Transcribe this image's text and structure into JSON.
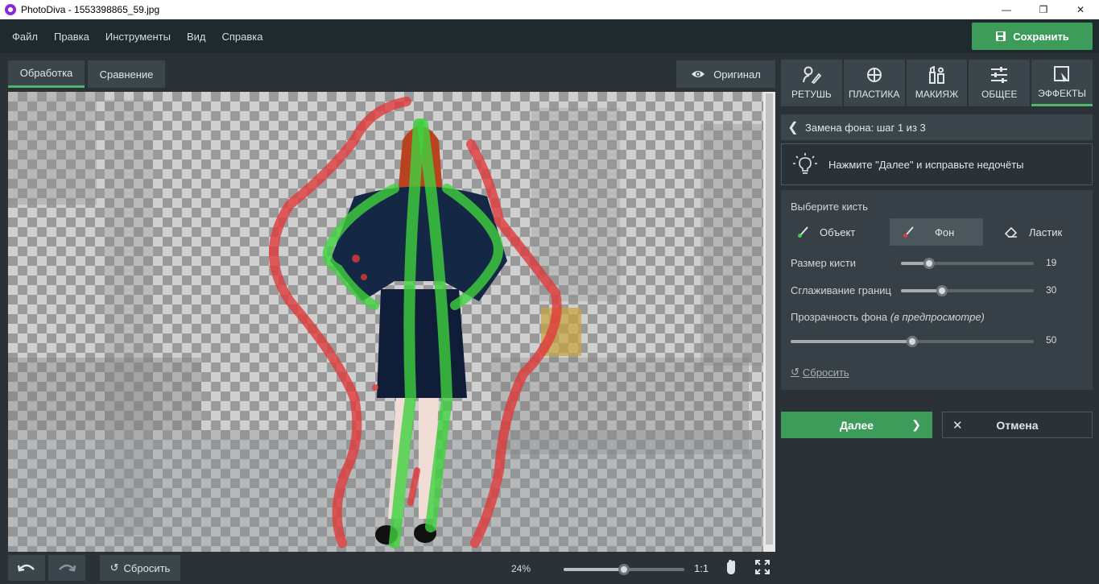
{
  "window": {
    "title": "PhotoDiva - 1553398865_59.jpg"
  },
  "menu": [
    "Файл",
    "Правка",
    "Инструменты",
    "Вид",
    "Справка"
  ],
  "save_button": "Сохранить",
  "view_tabs": {
    "process": "Обработка",
    "compare": "Сравнение",
    "original": "Оригинал"
  },
  "tools": [
    {
      "label": "РЕТУШЬ",
      "icon": "retouch-icon"
    },
    {
      "label": "ПЛАСТИКА",
      "icon": "plastic-icon"
    },
    {
      "label": "МАКИЯЖ",
      "icon": "makeup-icon"
    },
    {
      "label": "ОБЩЕЕ",
      "icon": "sliders-icon"
    },
    {
      "label": "ЭФФЕКТЫ",
      "icon": "effects-icon",
      "active": true
    }
  ],
  "step": {
    "title": "Замена фона: шаг 1 из 3"
  },
  "hint": "Нажмите \"Далее\" и исправьте недочёты",
  "brush": {
    "choose_label": "Выберите кисть",
    "options": {
      "object": "Объект",
      "background": "Фон",
      "eraser": "Ластик"
    },
    "selected": "background"
  },
  "settings": {
    "size": {
      "label": "Размер кисти",
      "value": 19,
      "fraction": 0.21
    },
    "smoothing": {
      "label": "Сглаживание границ",
      "value": 30,
      "fraction": 0.31
    },
    "opacity": {
      "label": "Прозрачность фона",
      "label_note": "(в предпросмотре)",
      "value": 50,
      "fraction": 0.5
    },
    "reset": "Сбросить"
  },
  "actions": {
    "next": "Далее",
    "cancel": "Отмена"
  },
  "bottom": {
    "reset": "Сбросить",
    "zoom": "24%",
    "zoom_fraction": 0.5,
    "one_to_one": "1:1"
  },
  "colors": {
    "accent": "#3e9c5b",
    "object_stroke": "#3fd23f",
    "background_stroke": "#e03a3a"
  }
}
